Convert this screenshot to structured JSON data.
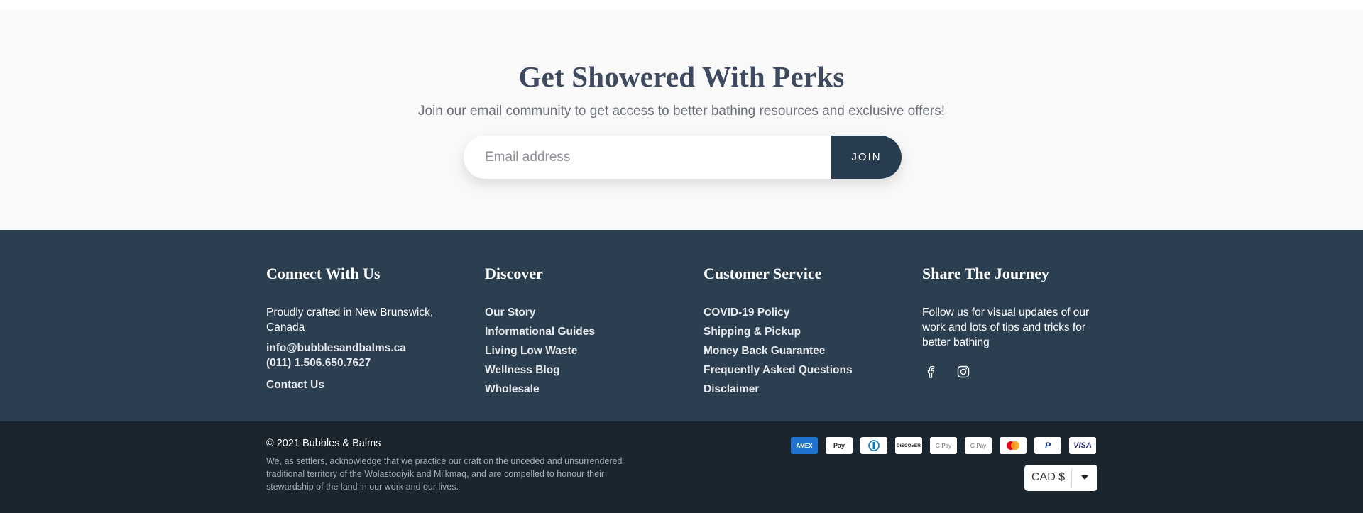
{
  "newsletter": {
    "title": "Get Showered With Perks",
    "subtitle": "Join our email community to get access to better bathing resources and exclusive offers!",
    "email_placeholder": "Email address",
    "join_label": "JOIN"
  },
  "footer": {
    "connect": {
      "title": "Connect With Us",
      "location": "Proudly crafted in New Brunswick, Canada",
      "email": "info@bubblesandbalms.ca",
      "phone": "(011) 1.506.650.7627",
      "contact_link": "Contact Us"
    },
    "discover": {
      "title": "Discover",
      "links": [
        "Our Story",
        "Informational Guides",
        "Living Low Waste",
        "Wellness Blog",
        "Wholesale"
      ]
    },
    "customer_service": {
      "title": "Customer Service",
      "links": [
        "COVID-19 Policy",
        "Shipping & Pickup",
        "Money Back Guarantee",
        "Frequently Asked Questions",
        "Disclaimer"
      ]
    },
    "share": {
      "title": "Share The Journey",
      "text": "Follow us for visual updates of our work and lots of tips and tricks for better bathing",
      "icons": [
        "facebook-icon",
        "instagram-icon"
      ]
    }
  },
  "bottom": {
    "copyright": "© 2021 Bubbles & Balms",
    "acknowledgement": "We, as settlers, acknowledge that we practice our craft on the unceded and unsurrendered traditional territory of the Wolastoqiyik and Mi'kmaq, and are compelled to honour their stewardship of the land in our work and our lives.",
    "payment_methods": [
      {
        "name": "amex-icon",
        "label": "AMEX"
      },
      {
        "name": "apple-pay-icon",
        "label": " Pay"
      },
      {
        "name": "diners-club-icon",
        "label": ""
      },
      {
        "name": "discover-icon",
        "label": "DISCOVER"
      },
      {
        "name": "google-pay-icon",
        "label": "G Pay"
      },
      {
        "name": "google-pay-alt-icon",
        "label": "G Pay"
      },
      {
        "name": "mastercard-icon",
        "label": ""
      },
      {
        "name": "paypal-icon",
        "label": "P"
      },
      {
        "name": "visa-icon",
        "label": "VISA"
      }
    ],
    "currency": "CAD $"
  },
  "colors": {
    "newsletter_bg": "#f9f9f9",
    "footer_bg": "#2b3f51",
    "bottom_bg": "#1b252d",
    "button_bg": "#273d4f",
    "title_color": "#3d4a60"
  }
}
